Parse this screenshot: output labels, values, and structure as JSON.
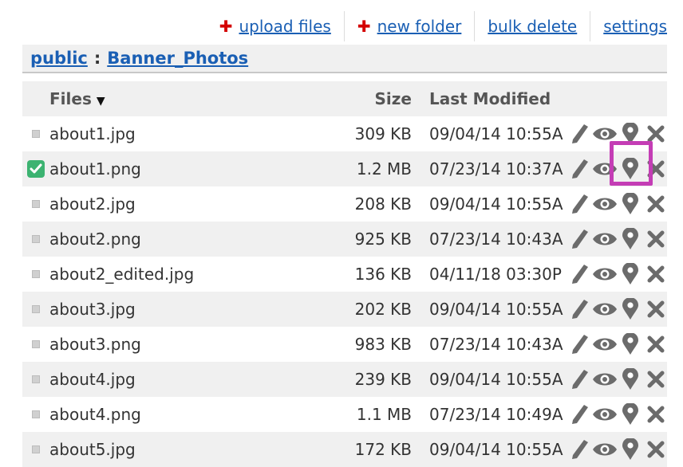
{
  "toolbar": {
    "upload_label": "upload files",
    "new_folder_label": "new folder",
    "bulk_delete_label": "bulk delete",
    "settings_label": "settings",
    "plus_glyph": "✚"
  },
  "breadcrumb": {
    "root": "public",
    "separator": ":",
    "current": "Banner_Photos"
  },
  "table": {
    "headers": {
      "files": "Files",
      "size": "Size",
      "modified": "Last Modified"
    },
    "rows": [
      {
        "name": "about1.jpg",
        "size": "309 KB",
        "modified": "09/04/14 10:55A",
        "selected": false
      },
      {
        "name": "about1.png",
        "size": "1.2 MB",
        "modified": "07/23/14 10:37A",
        "selected": true
      },
      {
        "name": "about2.jpg",
        "size": "208 KB",
        "modified": "09/04/14 10:55A",
        "selected": false
      },
      {
        "name": "about2.png",
        "size": "925 KB",
        "modified": "07/23/14 10:43A",
        "selected": false
      },
      {
        "name": "about2_edited.jpg",
        "size": "136 KB",
        "modified": "04/11/18 03:30P",
        "selected": false
      },
      {
        "name": "about3.jpg",
        "size": "202 KB",
        "modified": "09/04/14 10:55A",
        "selected": false
      },
      {
        "name": "about3.png",
        "size": "983 KB",
        "modified": "07/23/14 10:43A",
        "selected": false
      },
      {
        "name": "about4.jpg",
        "size": "239 KB",
        "modified": "09/04/14 10:55A",
        "selected": false
      },
      {
        "name": "about4.png",
        "size": "1.1 MB",
        "modified": "07/23/14 10:49A",
        "selected": false
      },
      {
        "name": "about5.jpg",
        "size": "172 KB",
        "modified": "09/04/14 10:55A",
        "selected": false
      }
    ],
    "actions": [
      "pencil-icon",
      "eye-icon",
      "map-pin-icon",
      "close-icon"
    ]
  },
  "colors": {
    "link": "#1a5fb4",
    "plus": "#d40000",
    "icon": "#6b6b6b",
    "check": "#3cb371",
    "highlight": "#c43db5"
  }
}
